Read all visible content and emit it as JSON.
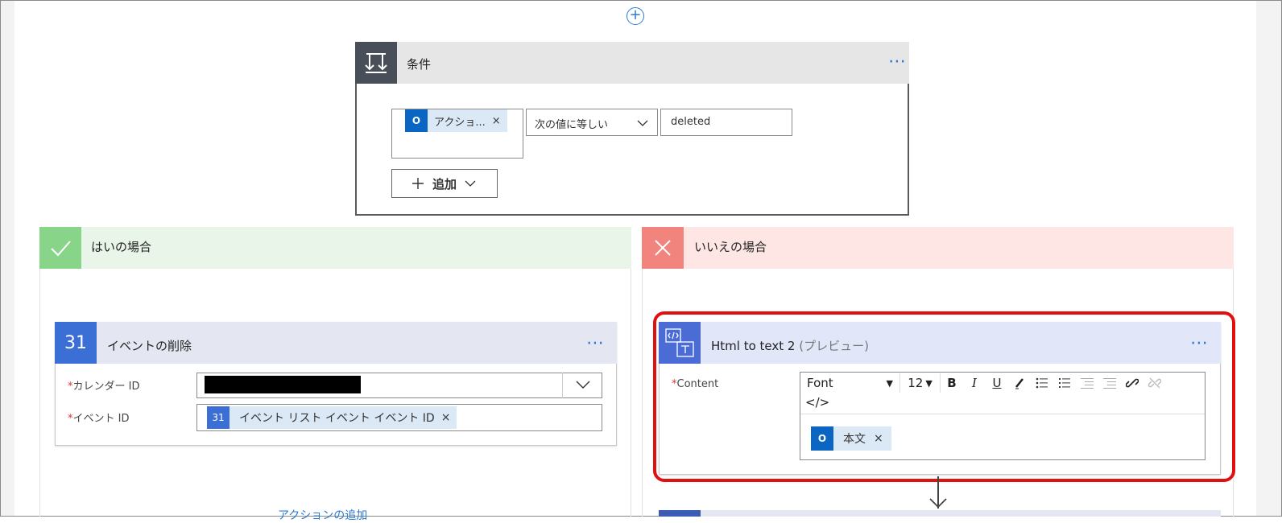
{
  "condition": {
    "title": "条件",
    "more_label": "⋯",
    "token_label": "アクショ...",
    "token_remove": "×",
    "operator": "次の値に等しい",
    "value": "deleted",
    "add_label": "追加",
    "token_icon": "outlook-icon",
    "condition_icon": "condition-icon"
  },
  "yes_branch": {
    "title": "はいの場合",
    "icon": "check-icon"
  },
  "no_branch": {
    "title": "いいえの場合",
    "icon": "close-icon"
  },
  "delete_event": {
    "title": "イベントの削除",
    "more_label": "⋯",
    "icon_text": "31",
    "calendar_label": "カレンダー ID",
    "event_label": "イベント ID",
    "event_token": "イベント リスト イベント イベント ID",
    "token_remove": "×",
    "required_mark": "*"
  },
  "add_action": {
    "label": "アクションの追加"
  },
  "html_to_text": {
    "title": "Html to text 2",
    "subtitle": "(プレビュー)",
    "more_label": "⋯",
    "content_label": "Content",
    "required_mark": "*",
    "font_label": "Font",
    "font_size": "12",
    "code_label": "</>",
    "token_label": "本文",
    "token_remove": "×"
  },
  "colors": {
    "accent": "#2b7bd4",
    "highlight": "#e01010",
    "yes": "#88d58a",
    "no": "#f2847e"
  }
}
